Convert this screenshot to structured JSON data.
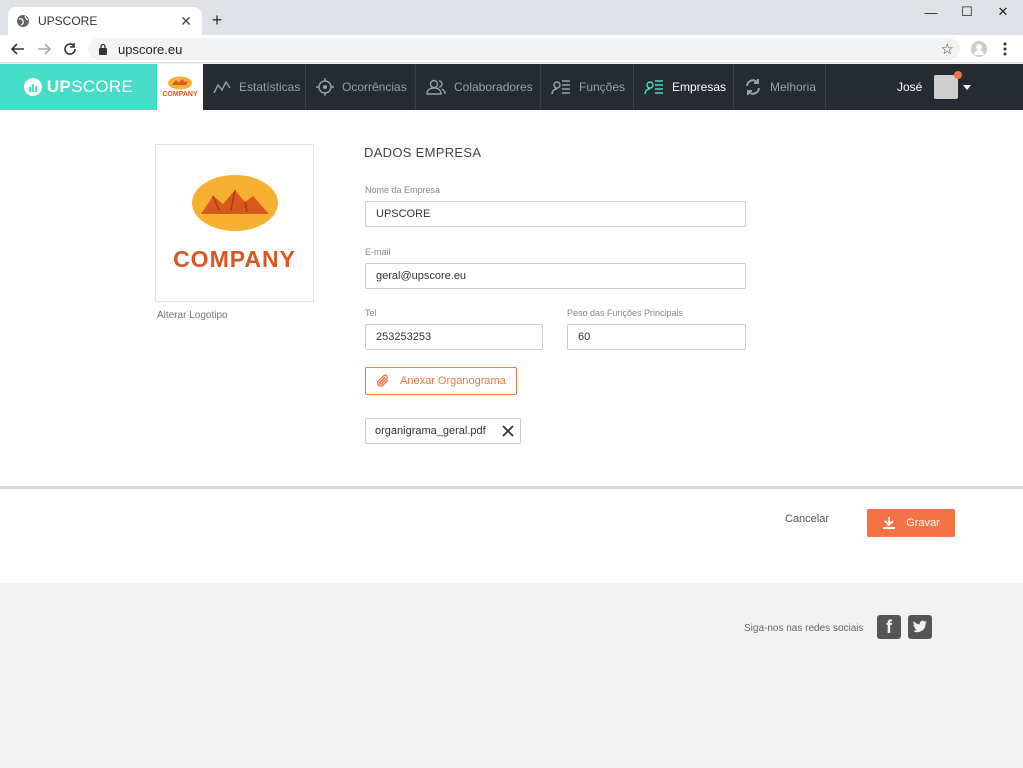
{
  "browser": {
    "tab_title": "UPSCORE",
    "url": "upscore.eu",
    "new_tab_glyph": "+",
    "tab_close_glyph": "✕",
    "minimize_glyph": "—",
    "maximize_glyph": "☐",
    "close_glyph": "✕",
    "bookmark_glyph": "☆"
  },
  "brand": {
    "name_bold": "UP",
    "name_rest": "SCORE",
    "company_tile_text": "COMPANY",
    "accent_color": "#45ddc8"
  },
  "nav": {
    "items": [
      {
        "label": "Estatísticas",
        "icon": "chart-line-icon",
        "active": false
      },
      {
        "label": "Ocorrências",
        "icon": "target-icon",
        "active": false
      },
      {
        "label": "Colaboradores",
        "icon": "users-icon",
        "active": false
      },
      {
        "label": "Funções",
        "icon": "functions-list-icon",
        "active": false
      },
      {
        "label": "Empresas",
        "icon": "company-list-icon",
        "active": true
      },
      {
        "label": "Melhoria",
        "icon": "refresh-icon",
        "active": false
      }
    ],
    "user_name": "José"
  },
  "company": {
    "logo_text": "COMPANY",
    "change_logo_label": "Alterar Logotipo",
    "section_title": "DADOS EMPRESA",
    "fields": {
      "name_label": "Nome da Empresa",
      "name_value": "UPSCORE",
      "email_label": "E-mail",
      "email_value": "geral@upscore.eu",
      "tel_label": "Tel",
      "tel_value": "253253253",
      "weight_label": "Peso das Funções Principais",
      "weight_value": "60"
    },
    "attach_label": "Anexar Organograma",
    "attached_file": "organigrama_geral.pdf"
  },
  "actions": {
    "cancel_label": "Cancelar",
    "save_label": "Gravar",
    "save_color": "#f47346"
  },
  "footer": {
    "social_text": "Siga-nos nas redes sociais",
    "facebook_glyph": "f"
  }
}
